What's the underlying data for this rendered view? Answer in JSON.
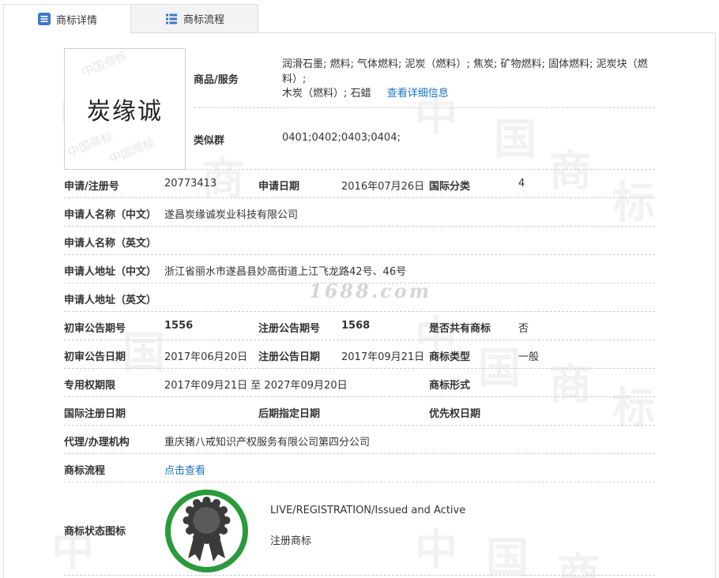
{
  "tabs": [
    {
      "label": "商标详情",
      "active": true,
      "icon": "list-icon"
    },
    {
      "label": "商标流程",
      "active": false,
      "icon": "table-icon"
    }
  ],
  "watermark": {
    "site": "1688.com",
    "chars": [
      "中",
      "国",
      "商",
      "标"
    ],
    "logo_marks": [
      "中国商标",
      "中国商标",
      "中国商标"
    ]
  },
  "trademark": {
    "name": "炭缘诚"
  },
  "goods": {
    "label": "商品/服务",
    "line1": "润滑石墨; 燃料; 气体燃料; 泥炭（燃料）; 焦炭; 矿物燃料; 固体燃料; 泥炭块（燃料）;",
    "line2": "木炭（燃料）; 石蜡",
    "detail_link": "查看详细信息"
  },
  "similar": {
    "label": "类似群",
    "value": "0401;0402;0403;0404;"
  },
  "rows": {
    "reg_no_label": "申请/注册号",
    "reg_no": "20773413",
    "apply_date_label": "申请日期",
    "apply_date": "2016年07月26日",
    "intl_class_label": "国际分类",
    "intl_class": "4",
    "applicant_cn_label": "申请人名称（中文）",
    "applicant_cn": "遂昌炭缘诚炭业科技有限公司",
    "applicant_en_label": "申请人名称（英文）",
    "applicant_en": "",
    "address_cn_label": "申请人地址（中文）",
    "address_cn": "浙江省丽水市遂昌县妙高街道上江飞龙路42号、46号",
    "address_en_label": "申请人地址（英文）",
    "address_en": "",
    "prelim_issue_label": "初审公告期号",
    "prelim_issue": "1556",
    "reg_issue_label": "注册公告期号",
    "reg_issue": "1568",
    "shared_label": "是否共有商标",
    "shared": "否",
    "prelim_date_label": "初审公告日期",
    "prelim_date": "2017年06月20日",
    "reg_date_label": "注册公告日期",
    "reg_date": "2017年09月21日",
    "type_label": "商标类型",
    "type": "一般",
    "term_label": "专用权期限",
    "term": "2017年09月21日 至 2027年09月20日",
    "form_label": "商标形式",
    "form": "",
    "intl_reg_date_label": "国际注册日期",
    "intl_reg_date": "",
    "later_date_label": "后期指定日期",
    "later_date": "",
    "priority_date_label": "优先权日期",
    "priority_date": "",
    "agent_label": "代理/办理机构",
    "agent": "重庆猪八戒知识产权服务有限公司第四分公司",
    "flow_label": "商标流程",
    "flow_link": "点击查看",
    "status_icon_label": "商标状态图标",
    "status_en": "LIVE/REGISTRATION/Issued and Active",
    "status_cn": "注册商标"
  },
  "colors": {
    "link": "#1a73c2",
    "award_ring": "#2a9a3c",
    "award_body": "#3a3a3a",
    "border": "#dcdcdc"
  }
}
